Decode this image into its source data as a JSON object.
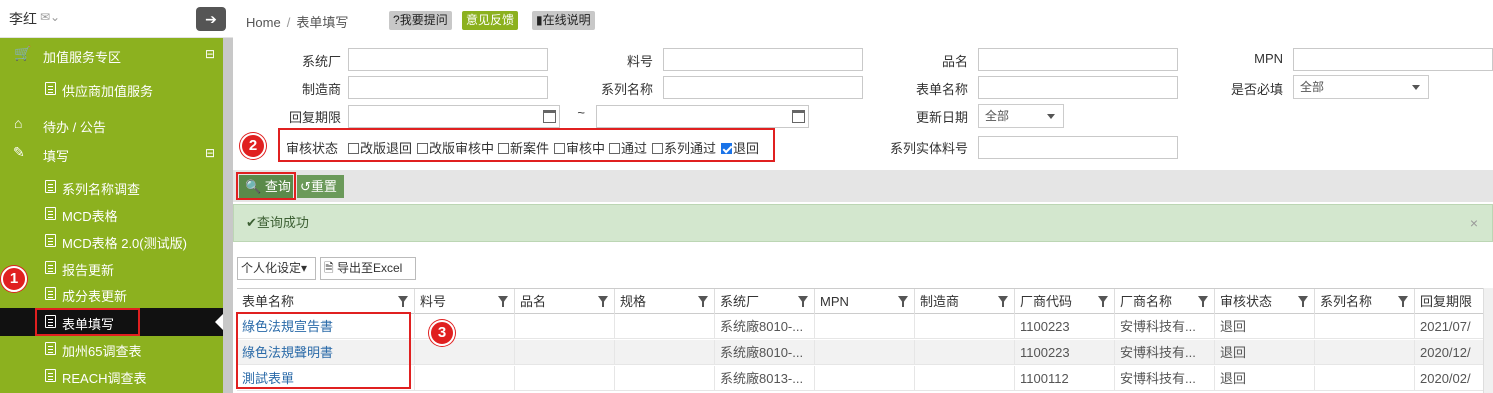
{
  "user": {
    "name": "李红"
  },
  "sidebar": {
    "sections": [
      {
        "label": "加值服务专区",
        "toggle": "⊟"
      },
      {
        "label": "供应商加值服务"
      },
      {
        "label": "待办 / 公告"
      },
      {
        "label": "填写",
        "toggle": "⊟"
      }
    ],
    "items": [
      {
        "label": "系列名称调查"
      },
      {
        "label": "MCD表格"
      },
      {
        "label": "MCD表格 2.0(测试版)"
      },
      {
        "label": "报告更新"
      },
      {
        "label": "成分表更新"
      },
      {
        "label": "表单填写"
      },
      {
        "label": "加州65调查表"
      },
      {
        "label": "REACH调查表"
      }
    ]
  },
  "badges": [
    "1",
    "2",
    "3"
  ],
  "breadcrumb": {
    "home": "Home",
    "sep": "/",
    "current": "表单填写"
  },
  "top_buttons": {
    "ask": "我要提问",
    "feedback": "意见反馈",
    "help": "在线说明"
  },
  "filters": {
    "system_factory": "系统厂",
    "part_no": "料号",
    "product_name": "品名",
    "mpn": "MPN",
    "manufacturer": "制造商",
    "series_name": "系列名称",
    "form_name": "表单名称",
    "required": "是否必填",
    "required_value": "全部",
    "reply_deadline": "回复期限",
    "tilde": "~",
    "update_date": "更新日期",
    "update_value": "全部",
    "review_status": "审核状态",
    "series_part_no": "系列实体料号",
    "status_options": [
      {
        "label": "改版退回",
        "checked": false
      },
      {
        "label": "改版审核中",
        "checked": false
      },
      {
        "label": "新案件",
        "checked": false
      },
      {
        "label": "审核中",
        "checked": false
      },
      {
        "label": "通过",
        "checked": false
      },
      {
        "label": "系列通过",
        "checked": false
      },
      {
        "label": "退回",
        "checked": true
      }
    ]
  },
  "toolbar": {
    "query": "查询",
    "reset": "重置"
  },
  "alert": {
    "message": "查询成功",
    "close": "×"
  },
  "grid_tools": {
    "personalize": "个人化设定",
    "export": "导出至Excel"
  },
  "table": {
    "columns": [
      "表单名称",
      "料号",
      "品名",
      "规格",
      "系统厂",
      "MPN",
      "制造商",
      "厂商代码",
      "厂商名称",
      "审核状态",
      "系列名称",
      "回复期限"
    ],
    "rows": [
      [
        "綠色法規宣告書",
        "",
        "",
        "",
        "系统廠8010-...",
        "",
        "",
        "1100223",
        "安博科技有...",
        "退回",
        "",
        "2021/07/"
      ],
      [
        "綠色法規聲明書",
        "",
        "",
        "",
        "系统廠8010-...",
        "",
        "",
        "1100223",
        "安博科技有...",
        "退回",
        "",
        "2020/12/"
      ],
      [
        "測試表單",
        "",
        "",
        "",
        "系统廠8013-...",
        "",
        "",
        "1100112",
        "安博科技有...",
        "退回",
        "",
        "2020/02/"
      ]
    ]
  }
}
